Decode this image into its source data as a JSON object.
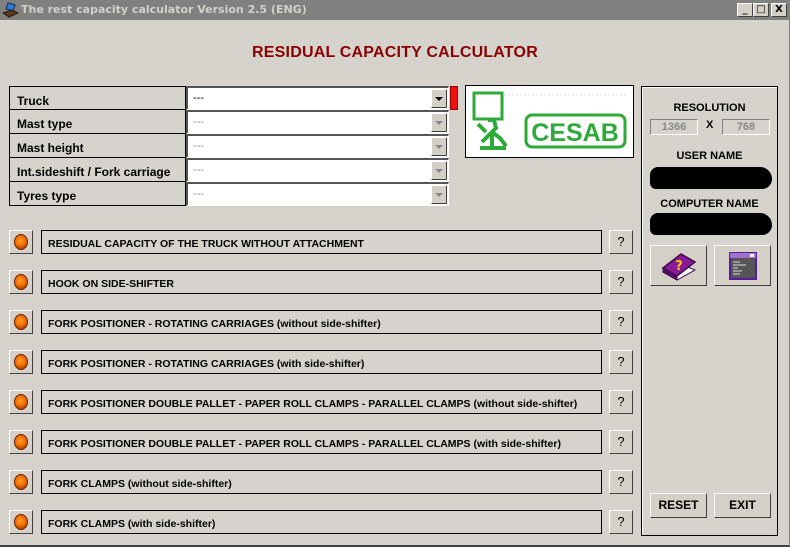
{
  "window": {
    "title": "The rest capacity calculator Version 2.5 (ENG)",
    "app_icon": "laptop-icon",
    "controls": {
      "minimize": "_",
      "maximize": "□",
      "close": "X"
    }
  },
  "header": {
    "title": "RESIDUAL CAPACITY CALCULATOR",
    "title_color": "#8b0000"
  },
  "parameters": [
    {
      "label": "Truck",
      "value": "---",
      "enabled": true
    },
    {
      "label": "Mast type",
      "value": "---",
      "enabled": false
    },
    {
      "label": "Mast height",
      "value": "---",
      "enabled": false
    },
    {
      "label": "Int.sideshift / Fork carriage",
      "value": "---",
      "enabled": false
    },
    {
      "label": "Tyres type",
      "value": "---",
      "enabled": false
    }
  ],
  "logo": {
    "text": "CESAB",
    "color": "#2eaa3a"
  },
  "side_panel": {
    "resolution_label": "RESOLUTION",
    "resolution_width": "1366",
    "resolution_separator": "X",
    "resolution_height": "768",
    "user_name_label": "USER NAME",
    "computer_name_label": "COMPUTER NAME",
    "help_book_icon": "help-book-icon",
    "window_list_icon": "window-list-icon",
    "reset_label": "RESET",
    "exit_label": "EXIT"
  },
  "attachments": [
    {
      "label": "RESIDUAL CAPACITY OF THE TRUCK WITHOUT ATTACHMENT",
      "help": "?"
    },
    {
      "label": "HOOK ON SIDE-SHIFTER",
      "help": "?"
    },
    {
      "label": "FORK POSITIONER - ROTATING CARRIAGES (without side-shifter)",
      "help": "?"
    },
    {
      "label": "FORK POSITIONER - ROTATING CARRIAGES (with side-shifter)",
      "help": "?"
    },
    {
      "label": "FORK POSITIONER DOUBLE PALLET - PAPER ROLL CLAMPS - PARALLEL CLAMPS (without side-shifter)",
      "help": "?"
    },
    {
      "label": "FORK POSITIONER DOUBLE PALLET - PAPER ROLL CLAMPS - PARALLEL CLAMPS (with side-shifter)",
      "help": "?"
    },
    {
      "label": "FORK CLAMPS (without side-shifter)",
      "help": "?"
    },
    {
      "label": "FORK CLAMPS (with side-shifter)",
      "help": "?"
    }
  ],
  "colors": {
    "background": "#d6d3cc",
    "titlebar": "#808080",
    "led": "#f07000",
    "marker": "#ee1111"
  }
}
